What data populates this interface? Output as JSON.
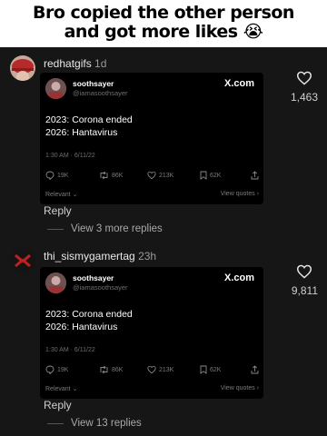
{
  "caption": {
    "line1": "Bro copied the other person",
    "line2": "and got more likes",
    "emoji": "😭"
  },
  "comments": [
    {
      "username": "redhatgifs",
      "time": "1d",
      "likes": "1,463",
      "avatar_icon": "red-hat-avatar",
      "reply_label": "Reply",
      "view_replies": "View 3 more replies",
      "card": {
        "name": "soothsayer",
        "handle": "@iamasoothsayer",
        "brand": "X.com",
        "line1": "2023: Corona ended",
        "line2": "2026: Hantavirus",
        "timestamp": "1:30 AM · 6/11/22",
        "stats": {
          "replies": "19K",
          "reposts": "86K",
          "likes": "213K",
          "bookmarks": "62K"
        },
        "relevant": "Relevant ⌄",
        "view_quotes": "View quotes ›"
      }
    },
    {
      "username": "thi_sismygamertag",
      "time": "23h",
      "likes": "9,811",
      "avatar_icon": "evangelion-avatar",
      "reply_label": "Reply",
      "view_replies": "View 13 replies",
      "card": {
        "name": "soothsayer",
        "handle": "@iamasoothsayer",
        "brand": "X.com",
        "line1": "2023: Corona ended",
        "line2": "2026: Hantavirus",
        "timestamp": "1:30 AM · 6/11/22",
        "stats": {
          "replies": "19K",
          "reposts": "86K",
          "likes": "213K",
          "bookmarks": "62K"
        },
        "relevant": "Relevant ⌄",
        "view_quotes": "View quotes ›"
      }
    }
  ]
}
